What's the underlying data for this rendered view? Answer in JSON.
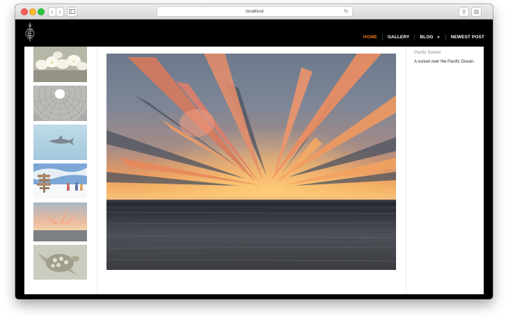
{
  "browser": {
    "address": "localhost",
    "back_glyph": "‹",
    "forward_glyph": "›",
    "reload_glyph": "↻",
    "share_glyph": "⇪",
    "tabs_glyph": "⧉"
  },
  "nav": {
    "items": [
      {
        "label": "HOME",
        "active": true
      },
      {
        "label": "GALLERY",
        "active": false
      },
      {
        "label": "BLOG",
        "active": false
      },
      {
        "label": "NEWEST POST",
        "active": false
      }
    ],
    "blog_caret": "▼"
  },
  "gallery": {
    "thumbnails": [
      {
        "subject": "white orchids"
      },
      {
        "subject": "dome oculus"
      },
      {
        "subject": "shark in blue water"
      },
      {
        "subject": "snowy signpost"
      },
      {
        "subject": "pacific sunset"
      },
      {
        "subject": "sea turtle"
      }
    ],
    "selected": {
      "title": "Pacific Sunset",
      "description": "A sunset over the Pacific Ocean."
    }
  },
  "colors": {
    "accent": "#f07a20",
    "header_bg": "#000000",
    "content_bg": "#ffffff"
  }
}
